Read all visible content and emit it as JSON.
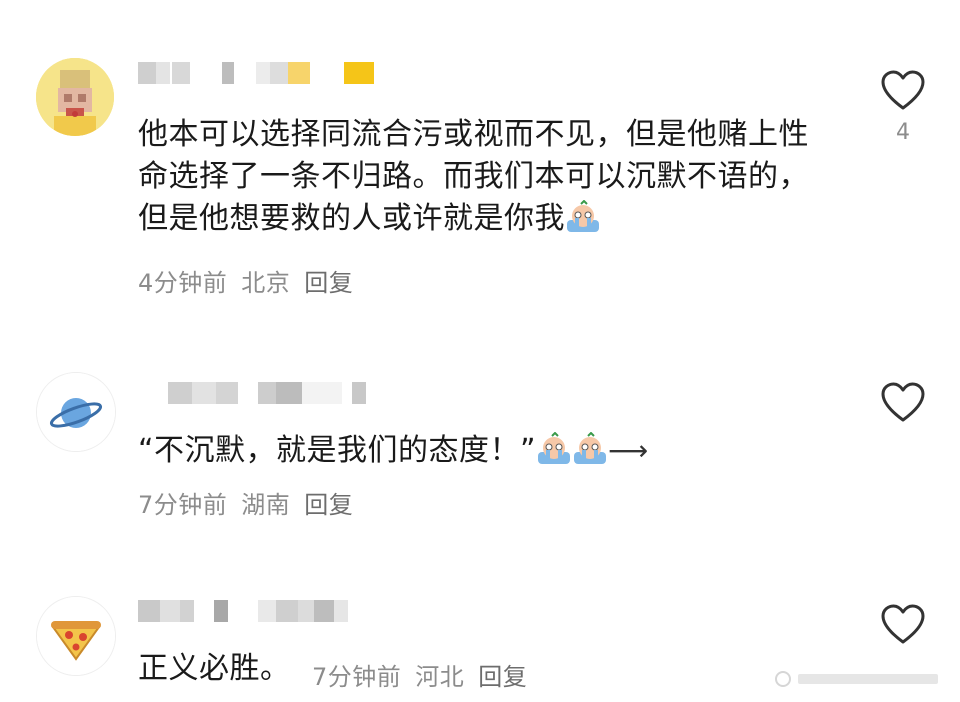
{
  "comments": [
    {
      "text_prefix": "他本可以选择同流合污或视而不见，但是他赌上性命选择了一条不归路。而我们本可以沉默不语的，但是他想要救的人或许就是你我",
      "time": "4分钟前",
      "location": "北京",
      "reply_label": "回复",
      "like_count": "4",
      "emoji": [
        "crying-emoji"
      ],
      "avatar_icon": "pixelated-avatar"
    },
    {
      "text_prefix": "“不沉默，就是我们的态度！”",
      "arrow": "⟶",
      "time": "7分钟前",
      "location": "湖南",
      "reply_label": "回复",
      "like_count": "",
      "emoji": [
        "crying-emoji",
        "crying-emoji"
      ],
      "avatar_icon": "planet-icon"
    },
    {
      "text_prefix": "正义必胜。",
      "time": "7分钟前",
      "location": "河北",
      "reply_label": "回复",
      "like_count": "",
      "emoji": [],
      "avatar_icon": "pizza-icon"
    }
  ],
  "colors": {
    "text": "#1a1a1a",
    "meta": "#8c8c8c",
    "heart_outline": "#333333",
    "blur_gold": "#f5c518"
  }
}
